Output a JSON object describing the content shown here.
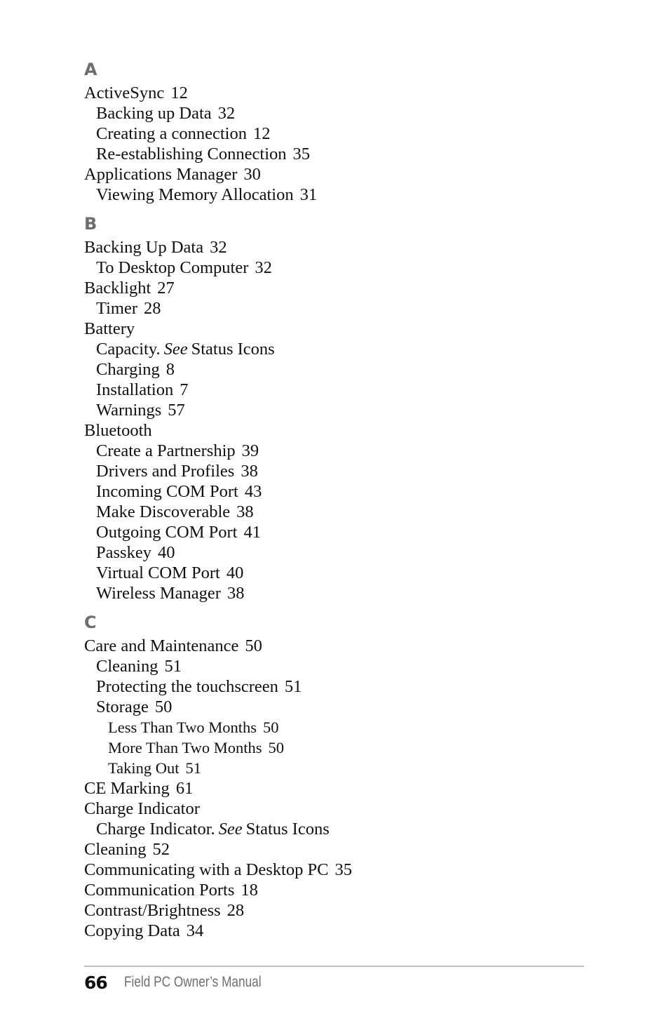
{
  "sections": [
    {
      "letter": "A",
      "entries": [
        {
          "level": 1,
          "text": "ActiveSync",
          "page": "12"
        },
        {
          "level": 2,
          "text": "Backing up Data",
          "page": "32"
        },
        {
          "level": 2,
          "text": "Creating a connection",
          "page": "12"
        },
        {
          "level": 2,
          "text": "Re-establishing Connection",
          "page": "35"
        },
        {
          "level": 1,
          "text": "Applications Manager",
          "page": "30"
        },
        {
          "level": 2,
          "text": "Viewing Memory Allocation",
          "page": "31"
        }
      ]
    },
    {
      "letter": "B",
      "entries": [
        {
          "level": 1,
          "text": "Backing Up Data",
          "page": "32"
        },
        {
          "level": 2,
          "text": "To Desktop Computer",
          "page": "32"
        },
        {
          "level": 1,
          "text": "Backlight",
          "page": "27"
        },
        {
          "level": 2,
          "text": "Timer",
          "page": "28"
        },
        {
          "level": 1,
          "text": "Battery",
          "page": ""
        },
        {
          "level": 2,
          "text": "Capacity.",
          "see": "See",
          "see_target": "Status Icons"
        },
        {
          "level": 2,
          "text": "Charging",
          "page": "8"
        },
        {
          "level": 2,
          "text": "Installation",
          "page": "7"
        },
        {
          "level": 2,
          "text": "Warnings",
          "page": "57"
        },
        {
          "level": 1,
          "text": "Bluetooth",
          "page": ""
        },
        {
          "level": 2,
          "text": "Create a Partnership",
          "page": "39"
        },
        {
          "level": 2,
          "text": "Drivers and Profiles",
          "page": "38"
        },
        {
          "level": 2,
          "text": "Incoming COM Port",
          "page": "43"
        },
        {
          "level": 2,
          "text": "Make Discoverable",
          "page": "38"
        },
        {
          "level": 2,
          "text": "Outgoing COM Port",
          "page": "41"
        },
        {
          "level": 2,
          "text": "Passkey",
          "page": "40"
        },
        {
          "level": 2,
          "text": "Virtual COM Port",
          "page": "40"
        },
        {
          "level": 2,
          "text": "Wireless Manager",
          "page": "38"
        }
      ]
    },
    {
      "letter": "C",
      "entries": [
        {
          "level": 1,
          "text": "Care and Maintenance",
          "page": "50"
        },
        {
          "level": 2,
          "text": "Cleaning",
          "page": "51"
        },
        {
          "level": 2,
          "text": "Protecting the touchscreen",
          "page": "51"
        },
        {
          "level": 2,
          "text": "Storage",
          "page": "50"
        },
        {
          "level": 3,
          "text": "Less Than Two Months",
          "page": "50"
        },
        {
          "level": 3,
          "text": "More Than Two Months",
          "page": "50"
        },
        {
          "level": 3,
          "text": "Taking Out",
          "page": "51"
        },
        {
          "level": 1,
          "text": "CE Marking",
          "page": "61"
        },
        {
          "level": 1,
          "text": "Charge Indicator",
          "page": ""
        },
        {
          "level": 2,
          "text": "Charge Indicator.",
          "see": "See",
          "see_target": "Status Icons"
        },
        {
          "level": 1,
          "text": "Cleaning",
          "page": "52"
        },
        {
          "level": 1,
          "text": "Communicating with a Desktop PC",
          "page": "35"
        },
        {
          "level": 1,
          "text": "Communication Ports",
          "page": "18"
        },
        {
          "level": 1,
          "text": "Contrast/Brightness",
          "page": "28"
        },
        {
          "level": 1,
          "text": "Copying Data",
          "page": "34"
        }
      ]
    }
  ],
  "footer": {
    "page_number": "66",
    "title": "Field PC Owner’s Manual"
  }
}
